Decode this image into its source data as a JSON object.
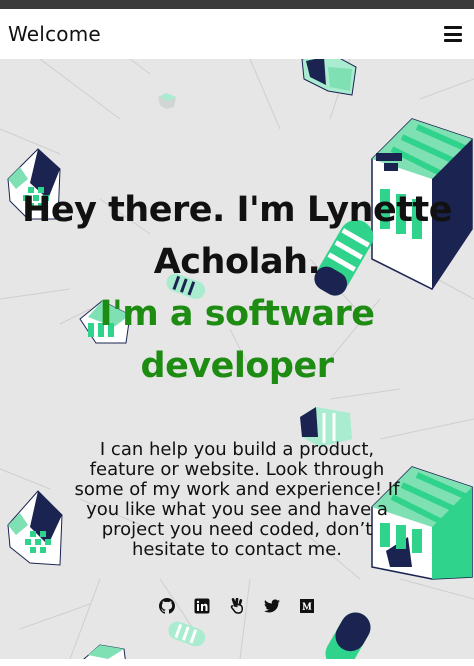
{
  "header": {
    "title": "Welcome",
    "menu_icon": "hamburger-menu-icon"
  },
  "hero": {
    "greeting": "Hey there. I'm Lynette Acholah.",
    "role": "I'm a software developer",
    "blurb": "I can help you build a product, feature or website. Look through some of my work and experience! If you like what you see and have a project you need coded, don’t hesitate to contact me."
  },
  "social": [
    {
      "icon": "github-icon"
    },
    {
      "icon": "linkedin-icon"
    },
    {
      "icon": "angellist-icon"
    },
    {
      "icon": "twitter-icon"
    },
    {
      "icon": "medium-icon"
    }
  ],
  "colors": {
    "accent": "#1e8c12",
    "background": "#e6e6e6",
    "text": "#111111",
    "decor_green": "#2fd38b",
    "decor_mint": "#a9ecd0",
    "decor_navy": "#1b2450"
  }
}
